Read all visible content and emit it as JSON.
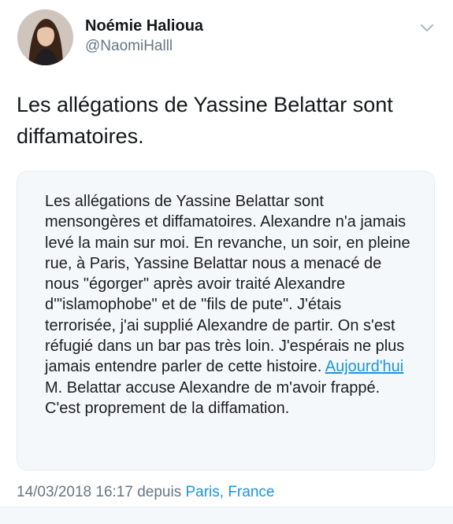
{
  "author": {
    "name": "Noémie Halioua",
    "handle": "@NaomiHalll"
  },
  "tweet": {
    "text": "Les allégations de Yassine Belattar sont diffamatoires."
  },
  "quoted_statement": {
    "text_before_link": "Les allégations de Yassine Belattar sont mensongères et diffamatoires. Alexandre n'a jamais levé la main sur moi. En revanche, un soir, en pleine rue, à Paris, Yassine Belattar nous a menacé de nous \"égorger\" après avoir traité Alexandre d'\"islamophobe\" et de \"fils de pute\". J'étais terrorisée, j'ai supplié Alexandre de partir. On s'est réfugié dans un bar pas très loin. J'espérais ne plus jamais entendre parler de cette histoire. ",
    "link_text": "Aujourd'hui",
    "text_after_link": " M. Belattar accuse Alexandre de m'avoir frappé. C'est proprement de la diffamation."
  },
  "meta": {
    "timestamp": "14/03/2018 16:17",
    "via": " depuis ",
    "location": "Paris, France"
  },
  "icons": {
    "avatar": "profile-photo",
    "menu": "chevron-down-icon"
  },
  "colors": {
    "link": "#1b95e0",
    "secondary_text": "#657786",
    "card_background": "#f5f8fa"
  }
}
